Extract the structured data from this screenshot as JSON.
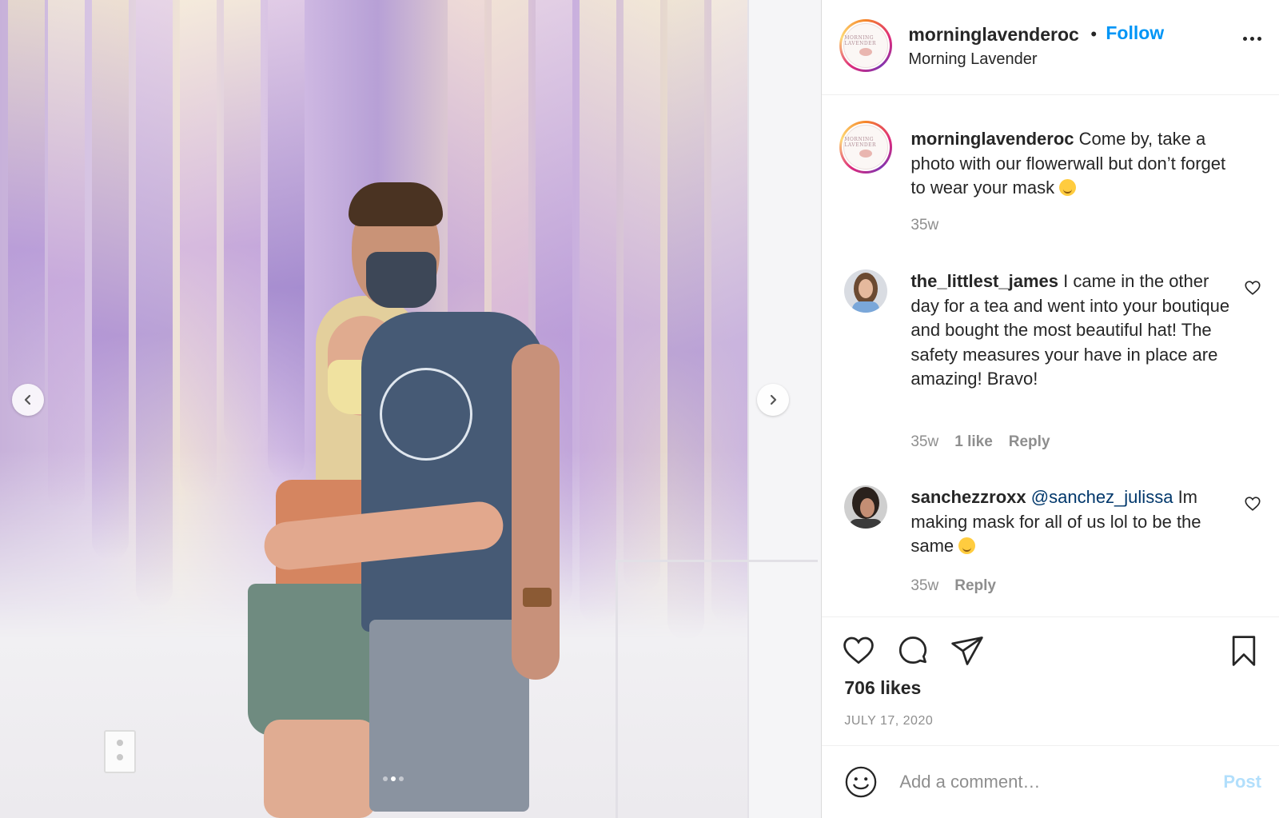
{
  "post": {
    "username": "morninglavenderoc",
    "bullet": "•",
    "follow_label": "Follow",
    "location": "Morning Lavender",
    "avatar_logo_text": "MORNING LAVENDER"
  },
  "caption": {
    "username": "morninglavenderoc",
    "text": "Come by, take a photo with our flowerwall but don’t forget to wear your mask",
    "emoji": "smiling-face",
    "time": "35w"
  },
  "comments": [
    {
      "username": "the_littlest_james",
      "text": "I came in the other day for a tea and went into your boutique and bought the most beautiful hat! The safety measures your have in place are amazing! Bravo!",
      "time": "35w",
      "likes": "1 like",
      "reply": "Reply"
    },
    {
      "username": "sanchezzroxx",
      "mention": "@sanchez_julissa",
      "text": "Im making mask for all of us lol to be the same",
      "emoji": "laughing-face",
      "time": "35w",
      "reply": "Reply"
    }
  ],
  "stats": {
    "likes": "706 likes",
    "date": "JULY 17, 2020"
  },
  "composer": {
    "placeholder": "Add a comment…",
    "post_label": "Post"
  },
  "carousel": {
    "current": 2,
    "total": 3
  },
  "icons": [
    "chevron-left-icon",
    "chevron-right-icon",
    "more-icon",
    "heart-icon",
    "comment-icon",
    "share-icon",
    "bookmark-icon",
    "emoji-icon"
  ],
  "colors": {
    "link": "#0095f6",
    "text": "#262626",
    "muted": "#8e8e8e",
    "post_disabled": "#b2dffc"
  }
}
